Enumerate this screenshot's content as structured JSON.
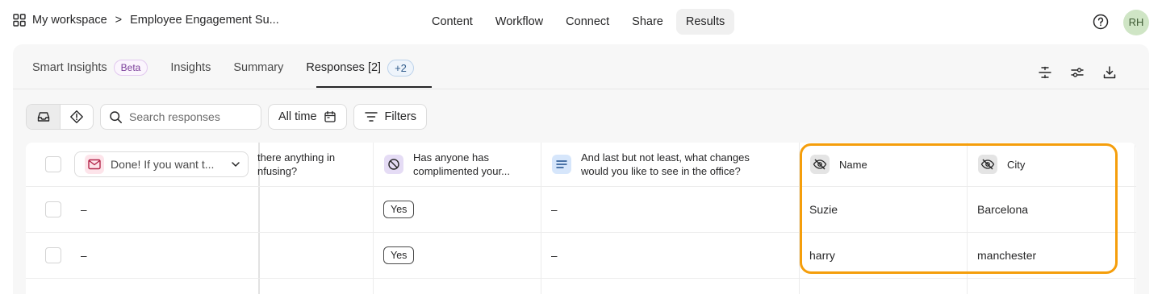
{
  "topbar": {
    "workspace": "My workspace",
    "breadcrumb_sep": ">",
    "form_title": "Employee Engagement Su...",
    "tabs": [
      {
        "label": "Content"
      },
      {
        "label": "Workflow"
      },
      {
        "label": "Connect"
      },
      {
        "label": "Share"
      },
      {
        "label": "Results",
        "active": true
      }
    ],
    "avatar_initials": "RH"
  },
  "subtabs": {
    "smart_insights": "Smart Insights",
    "beta": "Beta",
    "insights": "Insights",
    "summary": "Summary",
    "responses": "Responses [2]",
    "plus": "+2"
  },
  "toolbar": {
    "search_placeholder": "Search responses",
    "time_filter": "All time",
    "filters": "Filters"
  },
  "table": {
    "first_col_select": "Done! If you want t...",
    "columns": [
      {
        "label": "there anything in\nnfusing?",
        "icon": "none"
      },
      {
        "label": "Has anyone has\ncomplimented your...",
        "icon": "ban-icon",
        "color": "#e5dcf5"
      },
      {
        "label": "And last but not least, what changes\nwould you like to see in the office?",
        "icon": "text-lines-icon",
        "color": "#d6e6fb"
      },
      {
        "label": "Name",
        "icon": "eye-off-icon"
      },
      {
        "label": "City",
        "icon": "eye-off-icon"
      }
    ],
    "rows": [
      {
        "first": "–",
        "compliment": "Yes",
        "changes": "–",
        "name": "Suzie",
        "city": "Barcelona"
      },
      {
        "first": "–",
        "compliment": "Yes",
        "changes": "–",
        "name": "harry",
        "city": "manchester"
      }
    ]
  },
  "colors": {
    "highlight": "#f59e0b",
    "avatar_bg": "#cfe5c5",
    "email_icon_bg": "#fde4ea"
  }
}
